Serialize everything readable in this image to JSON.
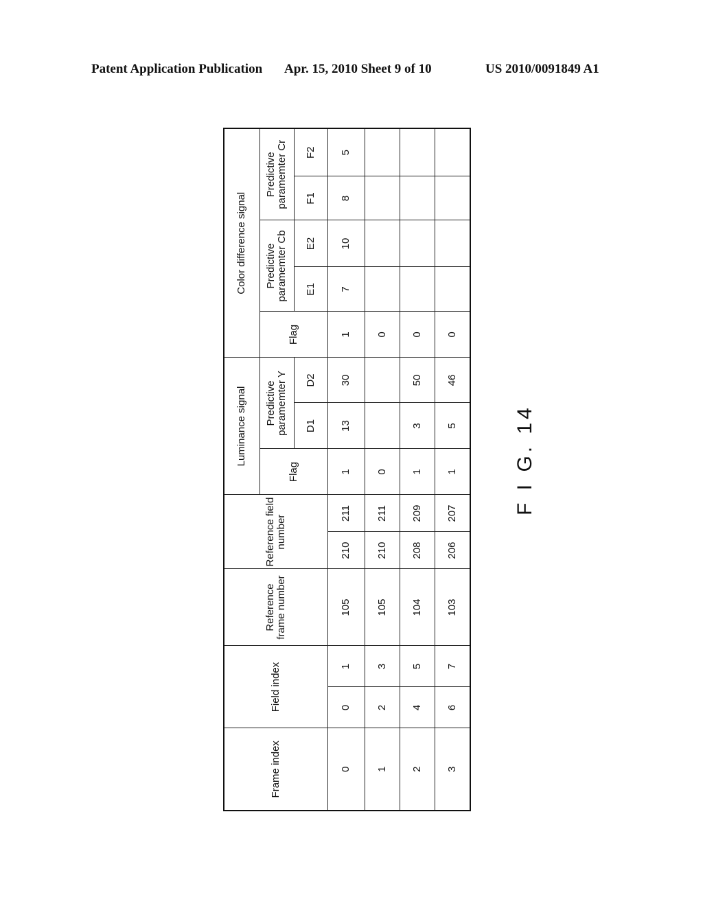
{
  "header": {
    "publication": "Patent Application Publication",
    "date_sheet": "Apr. 15, 2010  Sheet 9 of 10",
    "number": "US 2010/0091849 A1"
  },
  "figure_label": "F I G. 14",
  "table": {
    "headers": {
      "frame_index": "Frame index",
      "field_index": "Field index",
      "reference_frame_number": "Reference frame number",
      "reference_field_number": "Reference field number",
      "luminance_signal": "Luminance signal",
      "luminance_flag": "Flag",
      "predictive_y": "Predictive paramemter Y",
      "d1": "D1",
      "d2": "D2",
      "color_difference_signal": "Color difference signal",
      "color_flag": "Flag",
      "predictive_cb": "Predictive paramemter Cb",
      "e1": "E1",
      "e2": "E2",
      "predictive_cr": "Predictive paramemter Cr",
      "f1": "F1",
      "f2": "F2"
    },
    "rows": [
      {
        "frame_index": "0",
        "field_index": [
          "0",
          "1"
        ],
        "ref_frame": "105",
        "ref_field": [
          "210",
          "211"
        ],
        "lum_flag": "1",
        "d1": "13",
        "d2": "30",
        "color_flag": "1",
        "e1": "7",
        "e2": "10",
        "f1": "8",
        "f2": "5"
      },
      {
        "frame_index": "1",
        "field_index": [
          "2",
          "3"
        ],
        "ref_frame": "105",
        "ref_field": [
          "210",
          "211"
        ],
        "lum_flag": "0",
        "d1": "",
        "d2": "",
        "color_flag": "0",
        "e1": "",
        "e2": "",
        "f1": "",
        "f2": ""
      },
      {
        "frame_index": "2",
        "field_index": [
          "4",
          "5"
        ],
        "ref_frame": "104",
        "ref_field": [
          "208",
          "209"
        ],
        "lum_flag": "1",
        "d1": "3",
        "d2": "50",
        "color_flag": "0",
        "e1": "",
        "e2": "",
        "f1": "",
        "f2": ""
      },
      {
        "frame_index": "3",
        "field_index": [
          "6",
          "7"
        ],
        "ref_frame": "103",
        "ref_field": [
          "206",
          "207"
        ],
        "lum_flag": "1",
        "d1": "5",
        "d2": "46",
        "color_flag": "0",
        "e1": "",
        "e2": "",
        "f1": "",
        "f2": ""
      }
    ]
  }
}
